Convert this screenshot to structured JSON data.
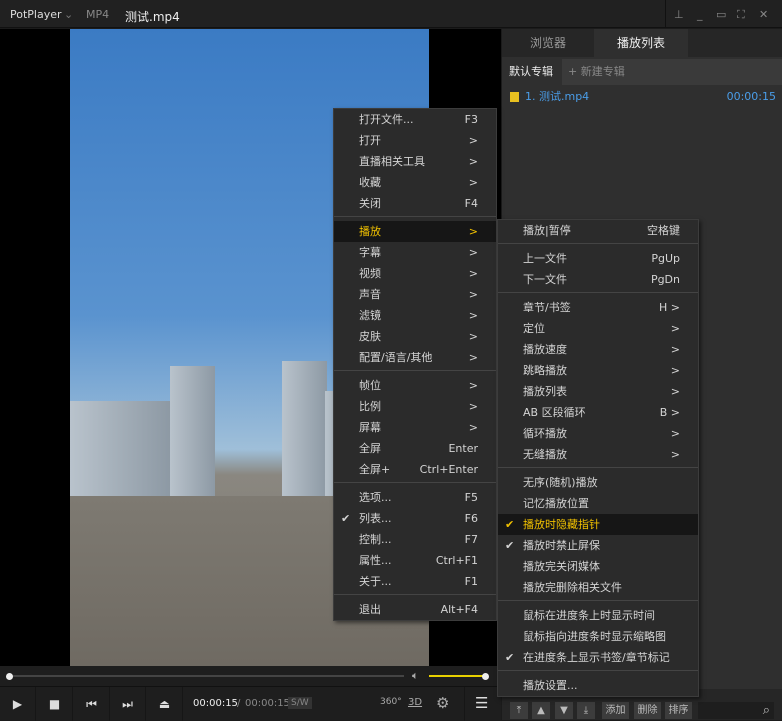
{
  "title": {
    "app": "PotPlayer",
    "format": "MP4",
    "file": "测试.mp4"
  },
  "window_controls": [
    "pin-icon",
    "minimize-icon",
    "maximize-icon",
    "fullscreen-icon",
    "close-icon"
  ],
  "panel": {
    "tabs": [
      "浏览器",
      "播放列表"
    ],
    "active_tab": 1,
    "albums": {
      "default": "默认专辑",
      "new": "+ 新建专辑"
    },
    "items": [
      {
        "name": "1. 测试.mp4",
        "duration": "00:00:15"
      }
    ],
    "buttons": [
      "添加",
      "删除",
      "排序"
    ]
  },
  "controls": {
    "current": "00:00:15",
    "sep": "/",
    "total": "00:00:15",
    "sw": "S/W",
    "b360": "360°",
    "b3d": "3D",
    "volume": 1.0,
    "progress": 0.0
  },
  "accent": "#f0c000",
  "main_menu": [
    {
      "label": "打开文件...",
      "key": "F3"
    },
    {
      "label": "打开",
      "key": ">"
    },
    {
      "label": "直播相关工具",
      "key": ">"
    },
    {
      "label": "收藏",
      "key": ">"
    },
    {
      "label": "关闭",
      "key": "F4"
    },
    {
      "sep": true
    },
    {
      "label": "播放",
      "key": ">",
      "highlight": true
    },
    {
      "label": "字幕",
      "key": ">"
    },
    {
      "label": "视频",
      "key": ">"
    },
    {
      "label": "声音",
      "key": ">"
    },
    {
      "label": "滤镜",
      "key": ">"
    },
    {
      "label": "皮肤",
      "key": ">"
    },
    {
      "label": "配置/语言/其他",
      "key": ">"
    },
    {
      "sep": true
    },
    {
      "label": "帧位",
      "key": ">"
    },
    {
      "label": "比例",
      "key": ">"
    },
    {
      "label": "屏幕",
      "key": ">"
    },
    {
      "label": "全屏",
      "key": "Enter"
    },
    {
      "label": "全屏+",
      "key": "Ctrl+Enter"
    },
    {
      "sep": true
    },
    {
      "label": "选项...",
      "key": "F5"
    },
    {
      "label": "列表...",
      "key": "F6",
      "checked": true
    },
    {
      "label": "控制...",
      "key": "F7"
    },
    {
      "label": "属性...",
      "key": "Ctrl+F1"
    },
    {
      "label": "关于...",
      "key": "F1"
    },
    {
      "sep": true
    },
    {
      "label": "退出",
      "key": "Alt+F4"
    }
  ],
  "sub_menu": [
    {
      "label": "播放|暂停",
      "key": "空格键"
    },
    {
      "sep": true
    },
    {
      "label": "上一文件",
      "key": "PgUp"
    },
    {
      "label": "下一文件",
      "key": "PgDn"
    },
    {
      "sep": true
    },
    {
      "label": "章节/书签",
      "key": "H >"
    },
    {
      "label": "定位",
      "key": ">"
    },
    {
      "label": "播放速度",
      "key": ">"
    },
    {
      "label": "跳略播放",
      "key": ">"
    },
    {
      "label": "播放列表",
      "key": ">"
    },
    {
      "label": "AB 区段循环",
      "key": "B >"
    },
    {
      "label": "循环播放",
      "key": ">"
    },
    {
      "label": "无缝播放",
      "key": ">"
    },
    {
      "sep": true
    },
    {
      "label": "无序(随机)播放"
    },
    {
      "label": "记忆播放位置"
    },
    {
      "label": "播放时隐藏指针",
      "checked": true,
      "highlight": true
    },
    {
      "label": "播放时禁止屏保",
      "checked": true
    },
    {
      "label": "播放完关闭媒体"
    },
    {
      "label": "播放完删除相关文件"
    },
    {
      "sep": true
    },
    {
      "label": "鼠标在进度条上时显示时间"
    },
    {
      "label": "鼠标指向进度条时显示缩略图"
    },
    {
      "label": "在进度条上显示书签/章节标记",
      "checked": true
    },
    {
      "sep": true
    },
    {
      "label": "播放设置..."
    }
  ]
}
